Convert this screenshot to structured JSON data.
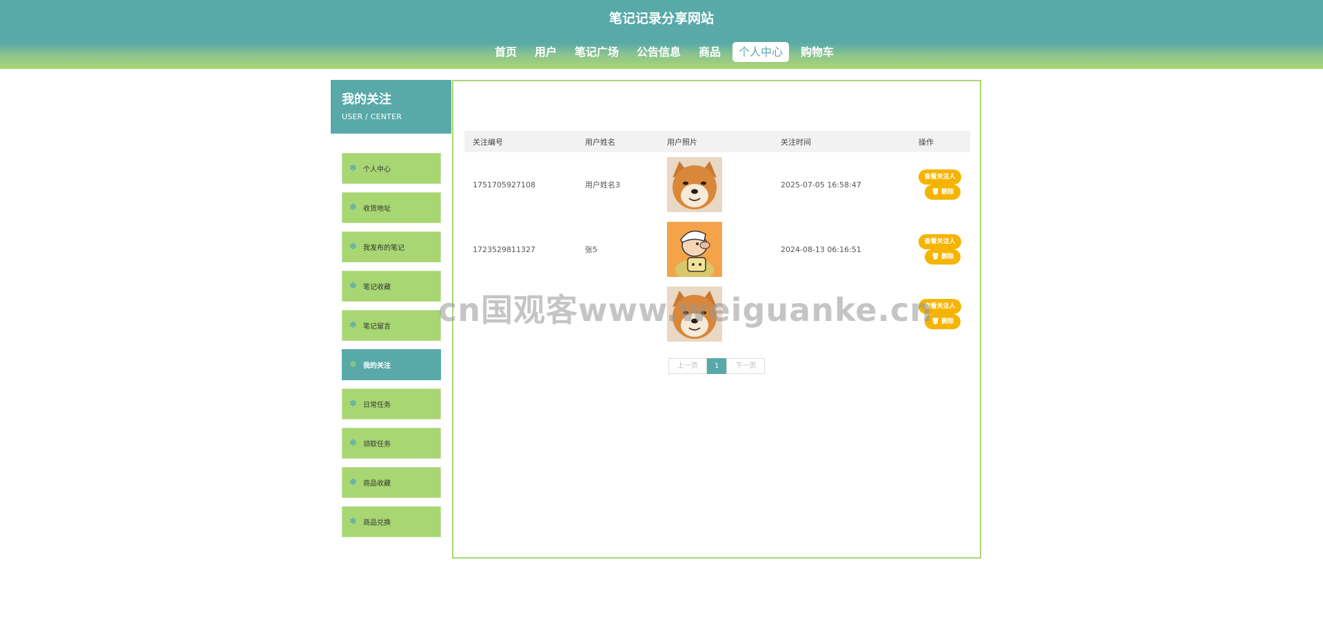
{
  "site": {
    "title": "笔记记录分享网站"
  },
  "nav": {
    "items": [
      "首页",
      "用户",
      "笔记广场",
      "公告信息",
      "商品",
      "个人中心",
      "购物车"
    ],
    "active": "个人中心"
  },
  "sidebar": {
    "title": "我的关注",
    "subtitle": "USER / CENTER",
    "items": [
      "个人中心",
      "收货地址",
      "我发布的笔记",
      "笔记收藏",
      "笔记留言",
      "我的关注",
      "日常任务",
      "领取任务",
      "商品收藏",
      "商品兑换"
    ],
    "active": "我的关注"
  },
  "table": {
    "headers": [
      "关注编号",
      "用户姓名",
      "用户照片",
      "关注时间",
      "操作"
    ],
    "rows": [
      {
        "id": "1751705927108",
        "name": "用户姓名3",
        "photo": "shiba-dog-photo",
        "time": "2025-07-05 16:58:47"
      },
      {
        "id": "1723529811327",
        "name": "张5",
        "photo": "cartoon-boy-photo",
        "time": "2024-08-13 06:16:51"
      },
      {
        "id": "",
        "name": "",
        "photo": "shiba-dog-photo",
        "time": ""
      }
    ],
    "view_label": "查看关注人",
    "delete_label": "删除"
  },
  "pager": {
    "prev": "上一页",
    "current": "1",
    "next": "下一页"
  },
  "watermark": {
    "text": "cn国观客www.weiguanke.cn"
  },
  "colors": {
    "teal": "#58a9a8",
    "green": "#a8d672",
    "button": "#f5b400"
  }
}
